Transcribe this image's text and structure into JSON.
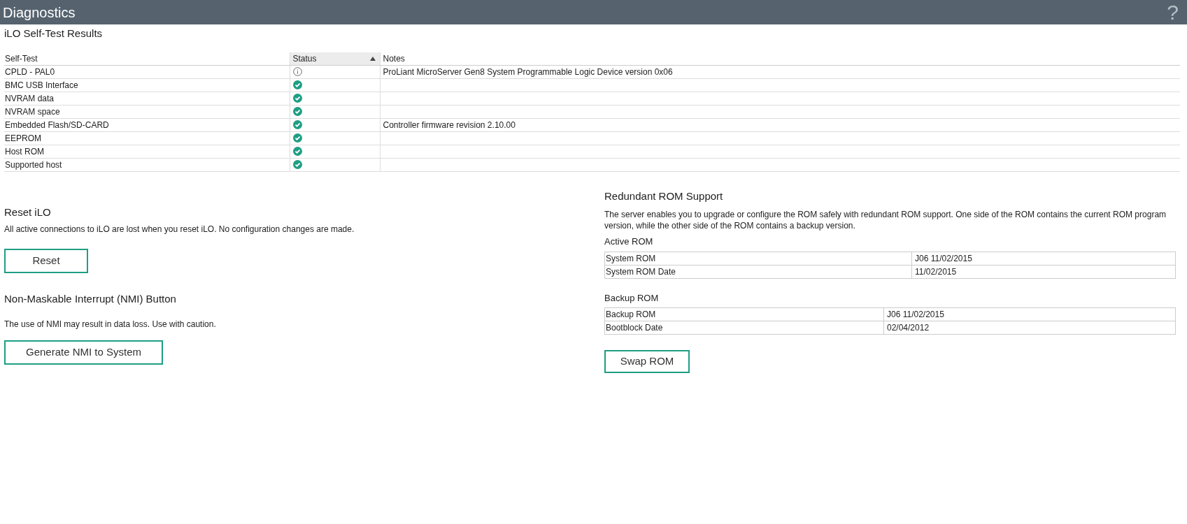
{
  "header": {
    "title": "Diagnostics",
    "help": "?"
  },
  "self_test": {
    "title": "iLO Self-Test Results",
    "columns": [
      {
        "label": "Self-Test",
        "sorted": false
      },
      {
        "label": "Status",
        "sorted": true
      },
      {
        "label": "Notes",
        "sorted": false
      }
    ],
    "rows": [
      {
        "test": "CPLD - PAL0",
        "kind": "info",
        "notes": "ProLiant MicroServer Gen8 System Programmable Logic Device version 0x06"
      },
      {
        "test": "BMC USB Interface",
        "kind": "pass"
      },
      {
        "test": "NVRAM data",
        "kind": "pass"
      },
      {
        "test": "NVRAM space",
        "kind": "pass"
      },
      {
        "test": "Embedded Flash/SD-CARD",
        "kind": "pass",
        "notes": "Controller firmware revision 2.10.00"
      },
      {
        "test": "EEPROM",
        "kind": "pass"
      },
      {
        "test": "Host ROM",
        "kind": "pass"
      },
      {
        "test": "Supported host",
        "kind": "pass"
      }
    ]
  },
  "reset": {
    "title": "Reset iLO",
    "text": "All active connections to iLO are lost when you reset iLO. No configuration changes are made.",
    "button": "Reset"
  },
  "nmi": {
    "title": "Non-Maskable Interrupt (NMI) Button",
    "text": "The use of NMI may result in data loss. Use with caution.",
    "button": "Generate NMI to System"
  },
  "redundant_rom": {
    "title": "Redundant ROM Support",
    "text": "The server enables you to upgrade or configure the ROM safely with redundant ROM support. One side of the ROM contains the current ROM program version, while the other side of the ROM contains a backup version.",
    "active": {
      "title": "Active ROM",
      "rows": [
        {
          "label": "System ROM",
          "value": "J06 11/02/2015"
        },
        {
          "label": "System ROM Date",
          "value": "11/02/2015"
        }
      ]
    },
    "backup": {
      "title": "Backup ROM",
      "rows": [
        {
          "label": "Backup ROM",
          "value": "J06 11/02/2015"
        },
        {
          "label": "Bootblock Date",
          "value": "02/04/2012"
        }
      ]
    },
    "button": "Swap ROM"
  }
}
